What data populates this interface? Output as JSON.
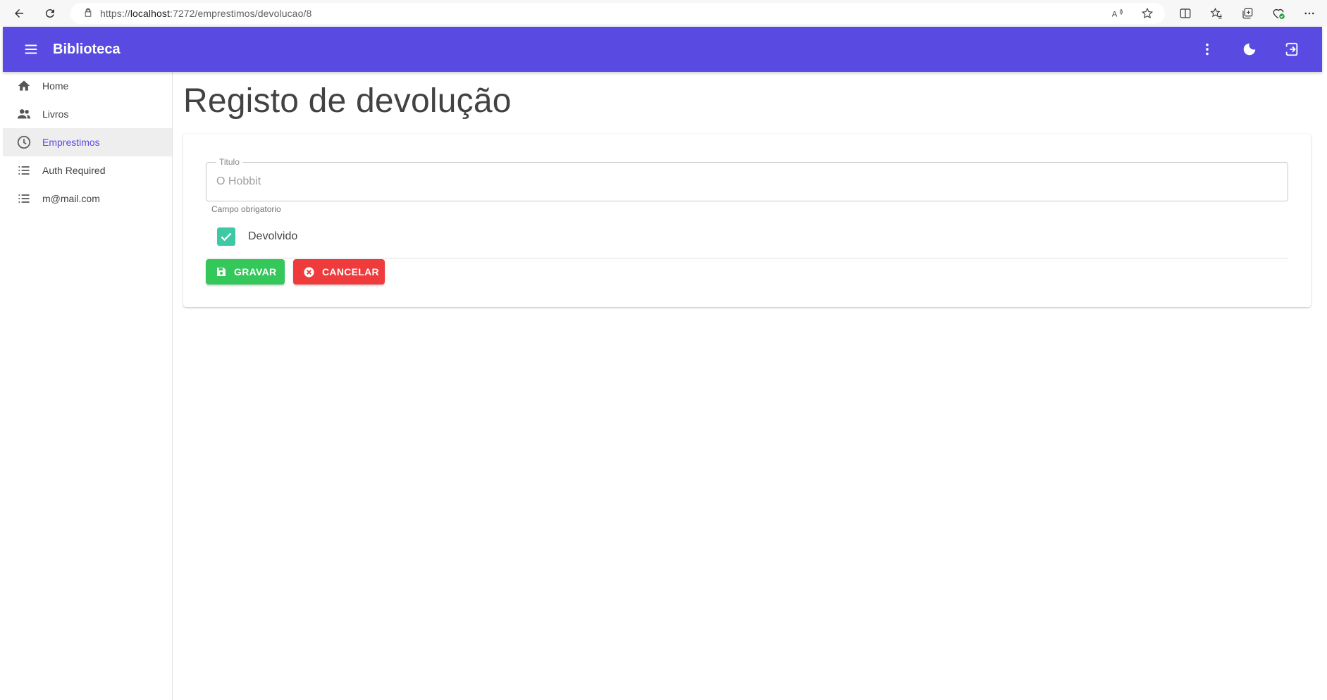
{
  "browser": {
    "url_prefix": "https://",
    "url_host": "localhost",
    "url_path": ":7272/emprestimos/devolucao/8",
    "icons": {
      "back": "back-arrow-icon",
      "reload": "reload-icon",
      "lock": "lock-icon",
      "read_aloud": "read-aloud-icon",
      "favorite": "star-icon",
      "split": "split-screen-icon",
      "favorites": "favorites-icon",
      "collections": "collections-icon",
      "extension": "browser-essentials-icon",
      "more": "more-icon"
    }
  },
  "app_bar": {
    "title": "Biblioteca",
    "color": "#594ae2",
    "icons": {
      "menu": "menu-icon",
      "more": "more-vert-icon",
      "theme": "dark-mode-icon",
      "logout": "logout-icon"
    }
  },
  "drawer": {
    "items": [
      {
        "label": "Home",
        "icon": "home-icon",
        "active": false
      },
      {
        "label": "Livros",
        "icon": "people-icon",
        "active": false
      },
      {
        "label": "Emprestimos",
        "icon": "clock-icon",
        "active": true
      },
      {
        "label": "Auth Required",
        "icon": "list-icon",
        "active": false
      },
      {
        "label": "m@mail.com",
        "icon": "list-icon",
        "active": false
      }
    ]
  },
  "page": {
    "title": "Registo de devolução"
  },
  "form": {
    "titulo_label": "Titulo",
    "titulo_value": "O Hobbit",
    "titulo_helper": "Campo obrigatorio",
    "devolvido_label": "Devolvido",
    "devolvido_checked": true,
    "save_label": "GRAVAR",
    "cancel_label": "CANCELAR",
    "colors": {
      "checkbox": "#3dc9a4",
      "save": "#34c75a",
      "cancel": "#ef3b3b"
    }
  }
}
